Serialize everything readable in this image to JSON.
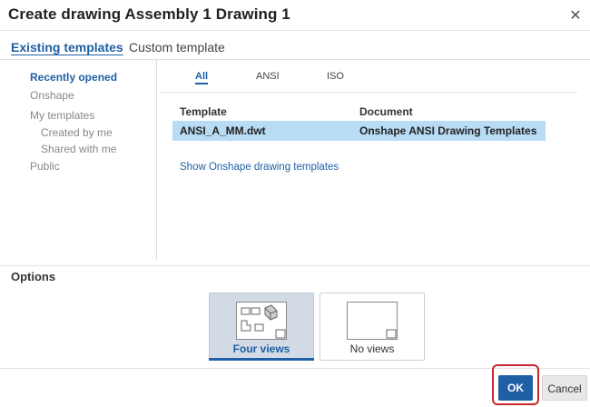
{
  "dialog": {
    "title": "Create drawing Assembly 1 Drawing 1",
    "close_icon": "close-icon"
  },
  "top_tabs": [
    {
      "label": "Existing templates",
      "active": true
    },
    {
      "label": "Custom template",
      "active": false
    }
  ],
  "sidebar": {
    "items": [
      {
        "label": "Recently opened",
        "active": true
      },
      {
        "label": "Onshape",
        "active": false
      },
      {
        "label": "My templates",
        "active": false
      },
      {
        "label": "Created by me",
        "active": false
      },
      {
        "label": "Shared with me",
        "active": false
      },
      {
        "label": "Public",
        "active": false
      }
    ]
  },
  "sub_tabs": [
    {
      "label": "All",
      "active": true
    },
    {
      "label": "ANSI",
      "active": false
    },
    {
      "label": "ISO",
      "active": false
    }
  ],
  "table": {
    "headers": [
      "Template",
      "Document"
    ],
    "rows": [
      {
        "template": "ANSI_A_MM.dwt",
        "document": "Onshape ANSI Drawing Templates",
        "selected": true
      }
    ]
  },
  "link": {
    "label": "Show Onshape drawing templates"
  },
  "options": {
    "title": "Options",
    "choices": [
      {
        "label": "Four views",
        "selected": true,
        "icon": "four-views-icon"
      },
      {
        "label": "No views",
        "selected": false,
        "icon": "no-views-icon"
      }
    ]
  },
  "footer": {
    "ok_label": "OK",
    "cancel_label": "Cancel"
  },
  "colors": {
    "accent": "#1f5fa5",
    "selected_row": "#b9dcf5",
    "selected_option": "#d2dbe5",
    "highlight": "#c9262d"
  }
}
